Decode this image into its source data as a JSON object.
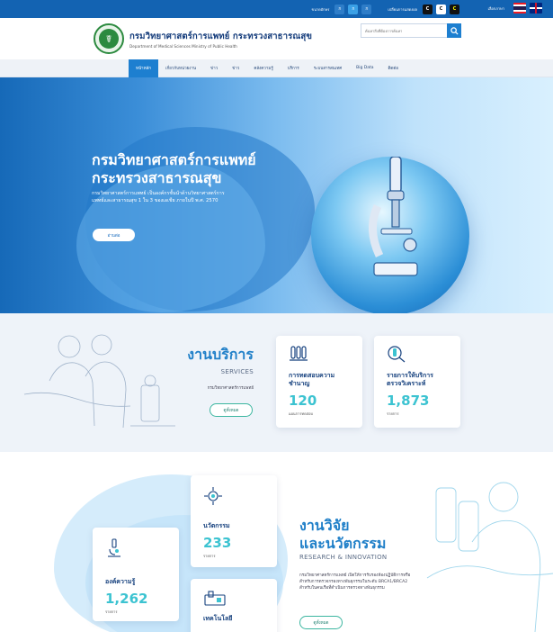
{
  "topbar": {
    "font_size_label": "ขนาดอักษร",
    "font_sizes": [
      "ก",
      "ก",
      "ก"
    ],
    "contrast_label": "เปลี่ยนการแสดงผล",
    "contrast_options": [
      "C",
      "C",
      "C"
    ],
    "language_label": "เลือกภาษา"
  },
  "header": {
    "org_name_th": "กรมวิทยาศาสตร์การแพทย์ กระทรวงสาธารณสุข",
    "org_name_en": "Department of Medical Sciences Ministry of Public Health",
    "search_placeholder": "ค้นหาสิ่งที่ต้องการค้นหา"
  },
  "nav": {
    "items": [
      "หน้าหลัก",
      "เกี่ยวกับหน่วยงาน",
      "ข่าว",
      "ข่าว",
      "คลังความรู้",
      "บริการ",
      "ระบบสารสนเทศ",
      "Big Data",
      "ติดต่อ"
    ],
    "active_index": 0
  },
  "hero": {
    "title_line1": "กรมวิทยาศาสตร์การแพทย์",
    "title_line2": "กระทรวงสาธารณสุข",
    "subtitle": "กรมวิทยาศาสตร์การแพทย์ เป็นองค์กรชั้นนำด้านวิทยาศาสตร์การแพทย์และสาธารณสุข 1 ใน 3 ของเอเชีย ภายในปี พ.ศ. 2570",
    "button": "อ่านต่อ",
    "slides": 3,
    "active_slide": 0
  },
  "services": {
    "title": "งานบริการ",
    "title_en": "SERVICES",
    "desc": "กรมวิทยาศาสตร์การแพทย์",
    "button": "ดูทั้งหมด",
    "cards": [
      {
        "title": "การทดสอบความชำนาญ",
        "value": "120",
        "unit": "แผนการทดสอบ",
        "icon": "lab-test-icon"
      },
      {
        "title": "รายการให้บริการตรวจวิเคราะห์",
        "value": "1,873",
        "unit": "รายการ",
        "icon": "analysis-icon"
      }
    ]
  },
  "research": {
    "title_line1": "งานวิจัย",
    "title_line2": "และนวัตกรรม",
    "title_en": "RESEARCH & INNOVATION",
    "desc": "กรมวิทยาศาสตร์การแพทย์ เปิดให้การรับรองห้องปฏิบัติการหรือสำหรับการตรวจกรองทางพันธุกรรมในระดับ BRCA1/BRCA2 สำหรับในคนเรือที่ดำเนินการตรวจทางพันธุกรรม",
    "button": "ดูทั้งหมด",
    "cards": [
      {
        "title": "นวัตกรรม",
        "value": "233",
        "unit": "รายการ",
        "icon": "innovation-icon"
      },
      {
        "title": "องค์ความรู้",
        "value": "1,262",
        "unit": "รายการ",
        "icon": "microscope-icon"
      },
      {
        "title": "เทคโนโลยี",
        "value": "",
        "unit": "",
        "icon": "technology-icon"
      }
    ]
  }
}
